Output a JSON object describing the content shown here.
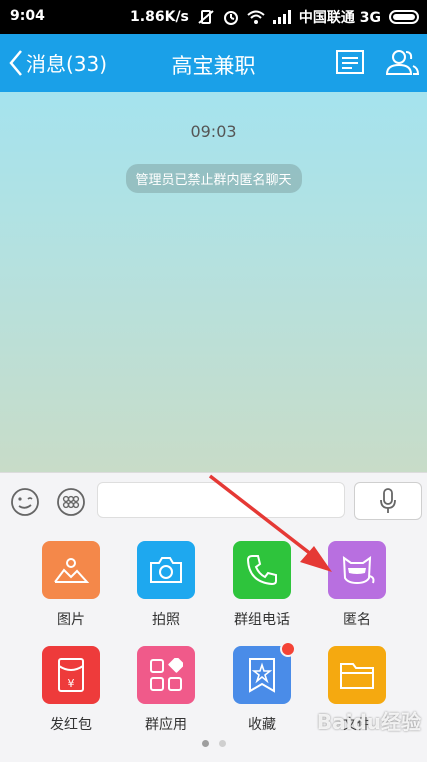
{
  "status_bar": {
    "time": "9:04",
    "speed": "1.86K/s",
    "carrier": "中国联通 3G"
  },
  "nav": {
    "back_label": "消息(33)",
    "title": "高宝兼职",
    "icons": [
      "chevron-left-icon",
      "menu-lines-icon",
      "group-people-icon"
    ]
  },
  "chat": {
    "timestamp": "09:03",
    "system_message": "管理员已禁止群内匿名聊天",
    "gradient": [
      "#a5e3ee",
      "#c8dcc8"
    ]
  },
  "input_bar": {
    "text_value": "",
    "icons": [
      "smiley-icon",
      "emoji-grid-icon",
      "microphone-icon"
    ]
  },
  "panel": {
    "tiles": [
      {
        "label": "图片",
        "color": "#F4884A",
        "icon": "picture-icon"
      },
      {
        "label": "拍照",
        "color": "#1EA8EF",
        "icon": "camera-icon"
      },
      {
        "label": "群组电话",
        "color": "#2EC43C",
        "icon": "phone-icon"
      },
      {
        "label": "匿名",
        "color": "#B86FE0",
        "icon": "anonymous-mask-icon"
      },
      {
        "label": "发红包",
        "color": "#EE3B3B",
        "icon": "red-packet-icon"
      },
      {
        "label": "群应用",
        "color": "#F05A8A",
        "icon": "apps-grid-icon"
      },
      {
        "label": "收藏",
        "color": "#4A8CE8",
        "icon": "bookmark-star-icon",
        "badge": true
      },
      {
        "label": "文件",
        "color": "#F5A910",
        "icon": "folder-icon"
      }
    ],
    "pager": {
      "pages": 2,
      "current": 1
    }
  },
  "annotation": {
    "arrow_color": "#E53935",
    "watermark": "Baidu经验"
  }
}
